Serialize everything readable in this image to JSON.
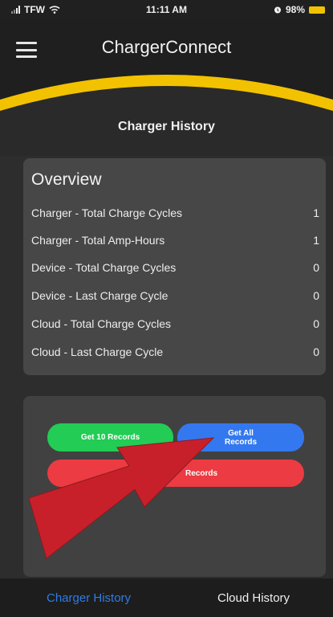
{
  "status_bar": {
    "carrier": "TFW",
    "time": "11:11 AM",
    "battery": "98%",
    "icons": [
      "signal-icon",
      "wifi-icon",
      "alarm-icon",
      "battery-icon"
    ]
  },
  "header": {
    "title": "ChargerConnect",
    "menu_icon": "hamburger-menu-icon",
    "accent_color": "#f2c200"
  },
  "page_title": "Charger History",
  "overview": {
    "heading": "Overview",
    "rows": [
      {
        "label": "Charger - Total Charge Cycles",
        "value": "1"
      },
      {
        "label": "Charger - Total Amp-Hours",
        "value": "1"
      },
      {
        "label": "Device - Total Charge Cycles",
        "value": "0"
      },
      {
        "label": "Device - Last Charge Cycle",
        "value": "0"
      },
      {
        "label": "Cloud - Total Charge Cycles",
        "value": "0"
      },
      {
        "label": "Cloud - Last Charge Cycle",
        "value": "0"
      }
    ]
  },
  "actions": {
    "get_10_label": "Get 10 Records",
    "get_all_line1": "Get All",
    "get_all_line2": "Records",
    "red_label": "Records",
    "colors": {
      "green": "#22cc55",
      "blue": "#3478f0",
      "red": "#ec3b42",
      "arrow": "#c8202a"
    }
  },
  "tabs": [
    {
      "label": "Charger History",
      "active": true
    },
    {
      "label": "Cloud History",
      "active": false
    }
  ]
}
